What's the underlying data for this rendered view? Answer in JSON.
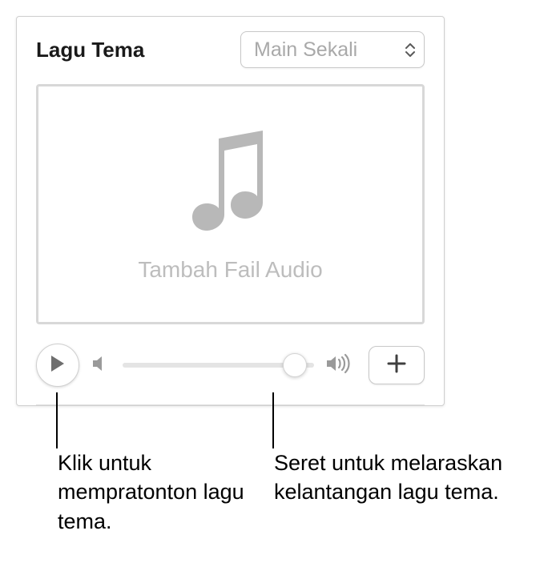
{
  "panel": {
    "title": "Lagu Tema",
    "dropdown": {
      "selected": "Main Sekali"
    },
    "dropzone": {
      "text": "Tambah Fail Audio"
    }
  },
  "callouts": {
    "play": "Klik untuk mempratonton lagu tema.",
    "volume": "Seret untuk melaraskan kelantangan lagu tema."
  }
}
